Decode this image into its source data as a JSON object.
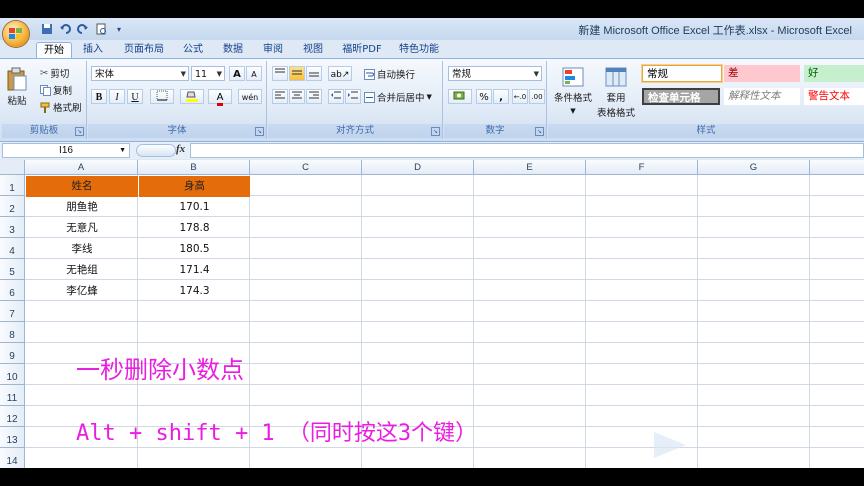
{
  "window": {
    "title": "新建 Microsoft Office Excel 工作表.xlsx - Microsoft Excel"
  },
  "tabs": [
    "开始",
    "插入",
    "页面布局",
    "公式",
    "数据",
    "审阅",
    "视图",
    "福昕PDF",
    "特色功能"
  ],
  "active_tab": "开始",
  "ribbon": {
    "clipboard": {
      "paste": "粘贴",
      "cut": "剪切",
      "copy": "复制",
      "format_painter": "格式刷",
      "label": "剪贴板"
    },
    "font": {
      "name": "宋体",
      "size": "11",
      "label": "字体",
      "bold": "B",
      "italic": "I",
      "underline": "U",
      "grow": "A",
      "shrink": "A",
      "font_color": "A",
      "phonetic": "wén"
    },
    "alignment": {
      "wrap": "自动换行",
      "merge": "合并后居中",
      "label": "对齐方式"
    },
    "number": {
      "format": "常规",
      "percent": "%",
      "comma": ",",
      "label": "数字",
      "increase": "←.0",
      "decrease": ".00"
    },
    "styles": {
      "conditional": "条件格式",
      "table_line1": "套用",
      "table_line2": "表格格式",
      "label": "样式",
      "cells": [
        {
          "text": "常规",
          "bg": "#ffffff",
          "color": "#000000"
        },
        {
          "text": "差",
          "bg": "#ffc7ce",
          "color": "#9c0006"
        },
        {
          "text": "好",
          "bg": "#c6efce",
          "color": "#006100"
        },
        {
          "text": "检查单元格",
          "bg": "#a5a5a5",
          "color": "#ffffff"
        },
        {
          "text": "解释性文本",
          "bg": "#ffffff",
          "color": "#7f7f7f"
        },
        {
          "text": "警告文本",
          "bg": "#ffffff",
          "color": "#ff0000"
        }
      ]
    }
  },
  "formula_bar": {
    "name_box": "I16",
    "fx": "fx",
    "value": ""
  },
  "columns": [
    "A",
    "B",
    "C",
    "D",
    "E",
    "F",
    "G"
  ],
  "rows": [
    "1",
    "2",
    "3",
    "4",
    "5",
    "6",
    "7",
    "8",
    "9",
    "10",
    "11",
    "12",
    "13",
    "14"
  ],
  "table": {
    "headers": [
      "姓名",
      "身高"
    ],
    "header_color": "#e46c0a",
    "rows": [
      [
        "朋鱼艳",
        "170.1"
      ],
      [
        "无意凡",
        "178.8"
      ],
      [
        "李线",
        "180.5"
      ],
      [
        "无艳组",
        "171.4"
      ],
      [
        "李亿蜂",
        "174.3"
      ]
    ]
  },
  "overlay": {
    "line1": "一秒删除小数点",
    "line2": "Alt + shift + 1  （同时按这3个键）",
    "color": "#e91ee0"
  }
}
